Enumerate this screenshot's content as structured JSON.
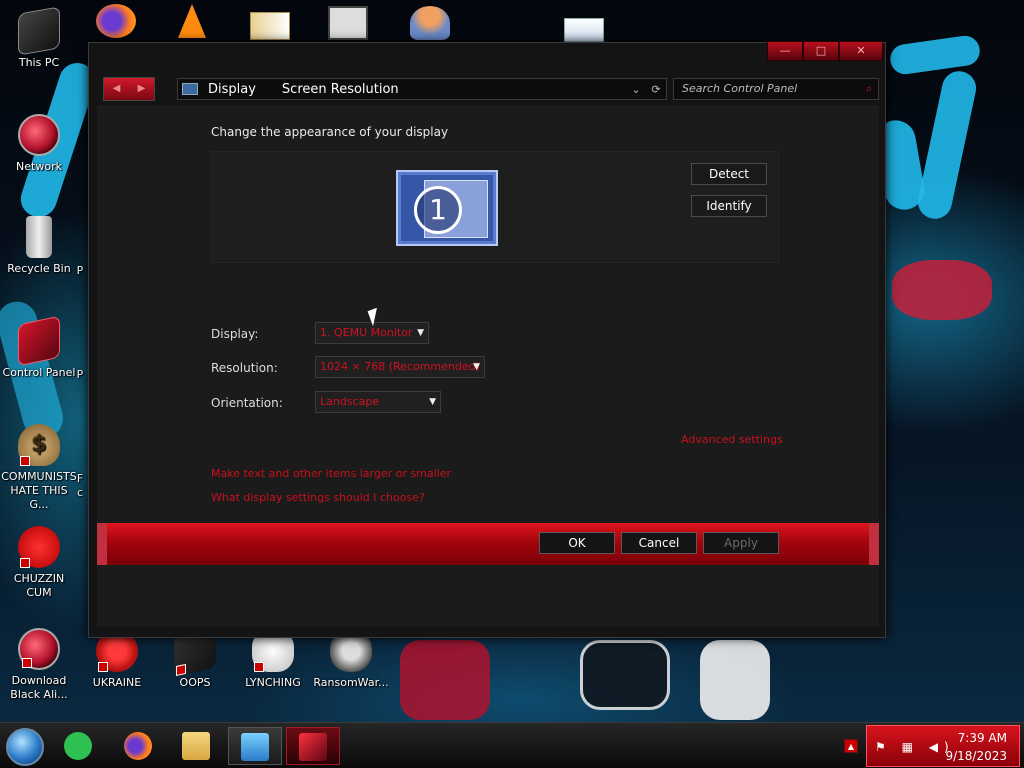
{
  "desktop": {
    "icons": [
      {
        "label": "This PC"
      },
      {
        "label": "Network"
      },
      {
        "label": "Recycle Bin"
      },
      {
        "label": "Control Panel"
      },
      {
        "label": "COMMUNISTS HATE THIS G..."
      },
      {
        "label": "CHUZZIN CUM"
      },
      {
        "label": "Download Black Ali..."
      },
      {
        "label": "UKRAINE"
      },
      {
        "label": "OOPS"
      },
      {
        "label": "LYNCHING"
      },
      {
        "label": "RansomWar..."
      }
    ],
    "partial_labels": [
      "P",
      "P",
      "F",
      "c"
    ]
  },
  "window": {
    "captions": {
      "minimize": "—",
      "maximize": "□",
      "close": "✕"
    },
    "nav": {
      "back": "◀",
      "forward": "▶"
    },
    "breadcrumb": [
      "Display",
      "Screen Resolution"
    ],
    "address_dropdown": "⌄",
    "refresh": "⟳",
    "search": {
      "placeholder": "Search Control Panel",
      "icon": "⌕"
    },
    "heading": "Change the appearance of your display",
    "preview": {
      "monitor_number": "1"
    },
    "buttons": {
      "detect": "Detect",
      "identify": "Identify"
    },
    "fields": {
      "display": {
        "label": "Display:",
        "value": "1. QEMU Monitor"
      },
      "resolution": {
        "label": "Resolution:",
        "value": "1024 × 768 (Recommended)"
      },
      "orientation": {
        "label": "Orientation:",
        "value": "Landscape"
      }
    },
    "links": {
      "advanced": "Advanced settings",
      "text_size": "Make text and other items larger or smaller",
      "which_settings": "What display settings should I choose?"
    },
    "footer": {
      "ok": "OK",
      "cancel": "Cancel",
      "apply": "Apply"
    }
  },
  "taskbar": {
    "tray_overflow": "▲",
    "tray_icons": "⚑ ▦ ◀)",
    "time": "7:39 AM",
    "date": "9/18/2023"
  },
  "colors": {
    "accent": "#d01020",
    "window_bg": "#141414"
  }
}
